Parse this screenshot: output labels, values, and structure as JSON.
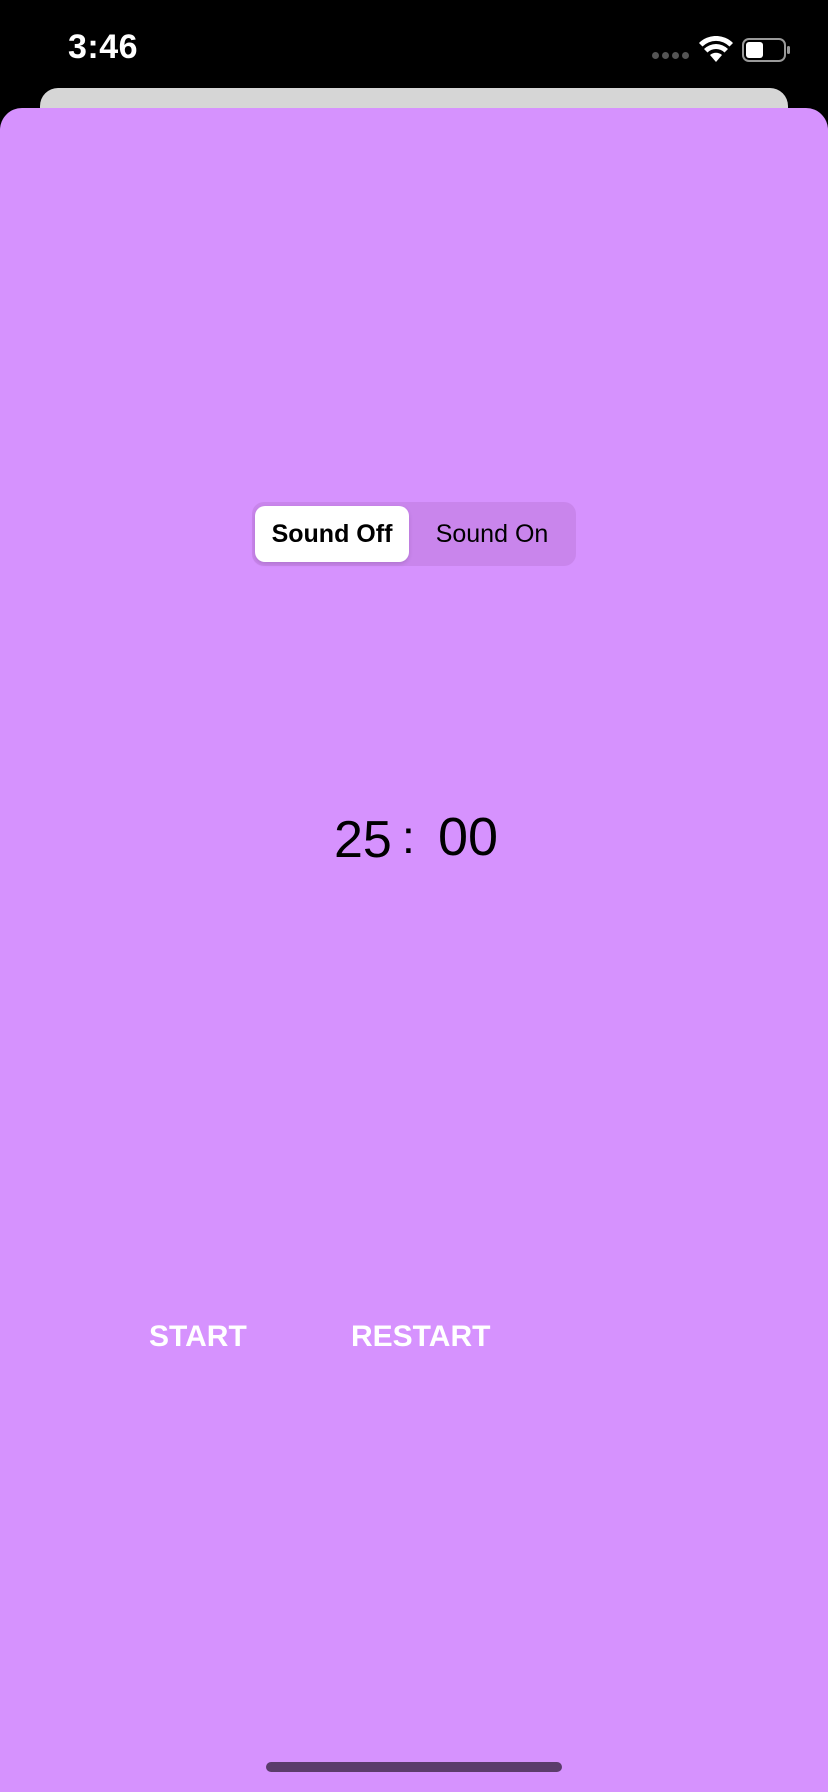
{
  "status_bar": {
    "time": "3:46"
  },
  "sound_toggle": {
    "options": [
      "Sound Off",
      "Sound On"
    ],
    "selected": "Sound Off"
  },
  "timer": {
    "minutes": "25",
    "separator": ":",
    "seconds": "00"
  },
  "controls": {
    "start_label": "START",
    "restart_label": "RESTART"
  },
  "colors": {
    "background": "#d692fe",
    "segment_track": "#c985ec",
    "segment_selected": "#ffffff",
    "button_text": "#ffffff"
  }
}
